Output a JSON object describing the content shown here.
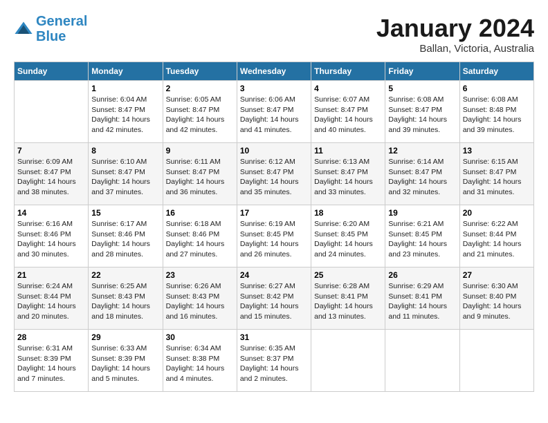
{
  "header": {
    "logo_line1": "General",
    "logo_line2": "Blue",
    "month_title": "January 2024",
    "subtitle": "Ballan, Victoria, Australia"
  },
  "weekdays": [
    "Sunday",
    "Monday",
    "Tuesday",
    "Wednesday",
    "Thursday",
    "Friday",
    "Saturday"
  ],
  "weeks": [
    [
      {
        "day": "",
        "info": ""
      },
      {
        "day": "1",
        "info": "Sunrise: 6:04 AM\nSunset: 8:47 PM\nDaylight: 14 hours\nand 42 minutes."
      },
      {
        "day": "2",
        "info": "Sunrise: 6:05 AM\nSunset: 8:47 PM\nDaylight: 14 hours\nand 42 minutes."
      },
      {
        "day": "3",
        "info": "Sunrise: 6:06 AM\nSunset: 8:47 PM\nDaylight: 14 hours\nand 41 minutes."
      },
      {
        "day": "4",
        "info": "Sunrise: 6:07 AM\nSunset: 8:47 PM\nDaylight: 14 hours\nand 40 minutes."
      },
      {
        "day": "5",
        "info": "Sunrise: 6:08 AM\nSunset: 8:47 PM\nDaylight: 14 hours\nand 39 minutes."
      },
      {
        "day": "6",
        "info": "Sunrise: 6:08 AM\nSunset: 8:48 PM\nDaylight: 14 hours\nand 39 minutes."
      }
    ],
    [
      {
        "day": "7",
        "info": "Sunrise: 6:09 AM\nSunset: 8:47 PM\nDaylight: 14 hours\nand 38 minutes."
      },
      {
        "day": "8",
        "info": "Sunrise: 6:10 AM\nSunset: 8:47 PM\nDaylight: 14 hours\nand 37 minutes."
      },
      {
        "day": "9",
        "info": "Sunrise: 6:11 AM\nSunset: 8:47 PM\nDaylight: 14 hours\nand 36 minutes."
      },
      {
        "day": "10",
        "info": "Sunrise: 6:12 AM\nSunset: 8:47 PM\nDaylight: 14 hours\nand 35 minutes."
      },
      {
        "day": "11",
        "info": "Sunrise: 6:13 AM\nSunset: 8:47 PM\nDaylight: 14 hours\nand 33 minutes."
      },
      {
        "day": "12",
        "info": "Sunrise: 6:14 AM\nSunset: 8:47 PM\nDaylight: 14 hours\nand 32 minutes."
      },
      {
        "day": "13",
        "info": "Sunrise: 6:15 AM\nSunset: 8:47 PM\nDaylight: 14 hours\nand 31 minutes."
      }
    ],
    [
      {
        "day": "14",
        "info": "Sunrise: 6:16 AM\nSunset: 8:46 PM\nDaylight: 14 hours\nand 30 minutes."
      },
      {
        "day": "15",
        "info": "Sunrise: 6:17 AM\nSunset: 8:46 PM\nDaylight: 14 hours\nand 28 minutes."
      },
      {
        "day": "16",
        "info": "Sunrise: 6:18 AM\nSunset: 8:46 PM\nDaylight: 14 hours\nand 27 minutes."
      },
      {
        "day": "17",
        "info": "Sunrise: 6:19 AM\nSunset: 8:45 PM\nDaylight: 14 hours\nand 26 minutes."
      },
      {
        "day": "18",
        "info": "Sunrise: 6:20 AM\nSunset: 8:45 PM\nDaylight: 14 hours\nand 24 minutes."
      },
      {
        "day": "19",
        "info": "Sunrise: 6:21 AM\nSunset: 8:45 PM\nDaylight: 14 hours\nand 23 minutes."
      },
      {
        "day": "20",
        "info": "Sunrise: 6:22 AM\nSunset: 8:44 PM\nDaylight: 14 hours\nand 21 minutes."
      }
    ],
    [
      {
        "day": "21",
        "info": "Sunrise: 6:24 AM\nSunset: 8:44 PM\nDaylight: 14 hours\nand 20 minutes."
      },
      {
        "day": "22",
        "info": "Sunrise: 6:25 AM\nSunset: 8:43 PM\nDaylight: 14 hours\nand 18 minutes."
      },
      {
        "day": "23",
        "info": "Sunrise: 6:26 AM\nSunset: 8:43 PM\nDaylight: 14 hours\nand 16 minutes."
      },
      {
        "day": "24",
        "info": "Sunrise: 6:27 AM\nSunset: 8:42 PM\nDaylight: 14 hours\nand 15 minutes."
      },
      {
        "day": "25",
        "info": "Sunrise: 6:28 AM\nSunset: 8:41 PM\nDaylight: 14 hours\nand 13 minutes."
      },
      {
        "day": "26",
        "info": "Sunrise: 6:29 AM\nSunset: 8:41 PM\nDaylight: 14 hours\nand 11 minutes."
      },
      {
        "day": "27",
        "info": "Sunrise: 6:30 AM\nSunset: 8:40 PM\nDaylight: 14 hours\nand 9 minutes."
      }
    ],
    [
      {
        "day": "28",
        "info": "Sunrise: 6:31 AM\nSunset: 8:39 PM\nDaylight: 14 hours\nand 7 minutes."
      },
      {
        "day": "29",
        "info": "Sunrise: 6:33 AM\nSunset: 8:39 PM\nDaylight: 14 hours\nand 5 minutes."
      },
      {
        "day": "30",
        "info": "Sunrise: 6:34 AM\nSunset: 8:38 PM\nDaylight: 14 hours\nand 4 minutes."
      },
      {
        "day": "31",
        "info": "Sunrise: 6:35 AM\nSunset: 8:37 PM\nDaylight: 14 hours\nand 2 minutes."
      },
      {
        "day": "",
        "info": ""
      },
      {
        "day": "",
        "info": ""
      },
      {
        "day": "",
        "info": ""
      }
    ]
  ]
}
